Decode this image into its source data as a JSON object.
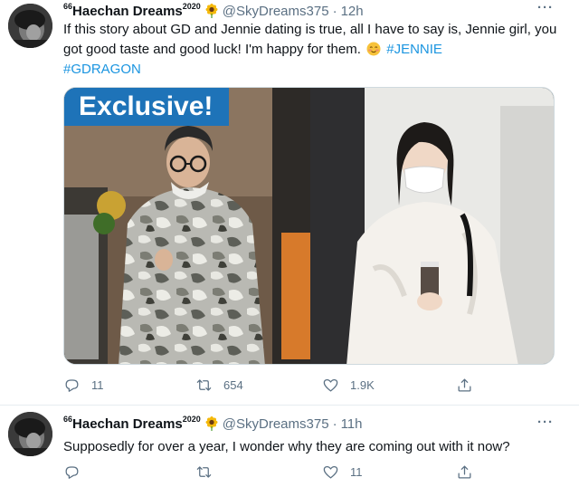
{
  "tweets": [
    {
      "display_name": "Haechan Dreams",
      "display_name_prefix": "66",
      "display_name_suffix": "2020",
      "handle": "@SkyDreams375",
      "separator": "·",
      "time": "12h",
      "text_main": "If this story about GD and Jennie dating is true, all I have to say is, Jennie girl, you got good taste and good luck! I'm happy for them.",
      "hashtags": [
        "#JENNIE",
        "#GDRAGON"
      ],
      "media": {
        "badge": "Exclusive!"
      },
      "actions": {
        "replies": "11",
        "retweets": "654",
        "likes": "1.9K"
      }
    },
    {
      "display_name": "Haechan Dreams",
      "display_name_prefix": "66",
      "display_name_suffix": "2020",
      "handle": "@SkyDreams375",
      "separator": "·",
      "time": "11h",
      "text_main": "Supposedly for over a year, I wonder why they are coming out with it now?",
      "actions": {
        "replies": "",
        "retweets": "",
        "likes": "11"
      }
    }
  ],
  "icons": {
    "reply": "reply-icon",
    "retweet": "retweet-icon",
    "like": "heart-icon",
    "share": "share-icon",
    "more": "more-icon",
    "sunflower": "sunflower-emoji",
    "blush": "smiling-face-emoji"
  },
  "colors": {
    "hashtag": "#1b95e0",
    "secondary_text": "#5b7083",
    "badge": "#1e73b8"
  }
}
